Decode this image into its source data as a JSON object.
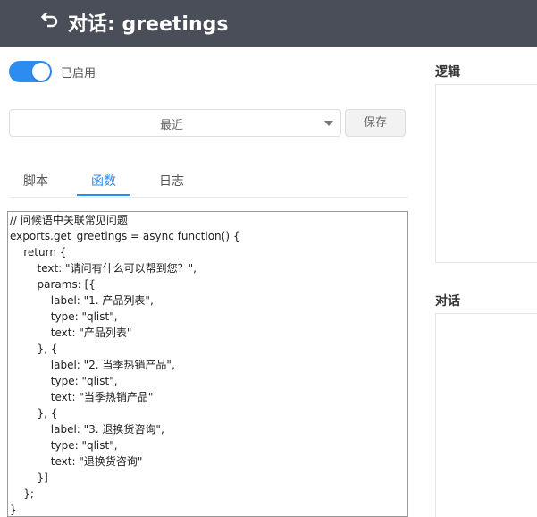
{
  "header": {
    "back_icon": "back-arrow-icon",
    "title": "对话: greetings",
    "background": "#4a4e58"
  },
  "toggle": {
    "enabled": true,
    "label": "已启用",
    "color": "#2d8cf0"
  },
  "toolbar": {
    "select_value": "最近",
    "save_label": "保存"
  },
  "tabs": [
    {
      "label": "脚本",
      "active": false
    },
    {
      "label": "函数",
      "active": true
    },
    {
      "label": "日志",
      "active": false
    }
  ],
  "code": {
    "lines": [
      "// 问候语中关联常见问题",
      "exports.get_greetings = async function() {",
      "    return {",
      "        text: \"请问有什么可以帮到您？\",",
      "        params: [{",
      "            label: \"1. 产品列表\",",
      "            type: \"qlist\",",
      "            text: \"产品列表\"",
      "        }, {",
      "            label: \"2. 当季热销产品\",",
      "            type: \"qlist\",",
      "            text: \"当季热销产品\"",
      "        }, {",
      "            label: \"3. 退换货咨询\",",
      "            type: \"qlist\",",
      "            text: \"退换货咨询\"",
      "        }]",
      "    };",
      "}"
    ]
  },
  "right_panels": {
    "logic_title": "逻辑",
    "dialog_title": "对话"
  }
}
